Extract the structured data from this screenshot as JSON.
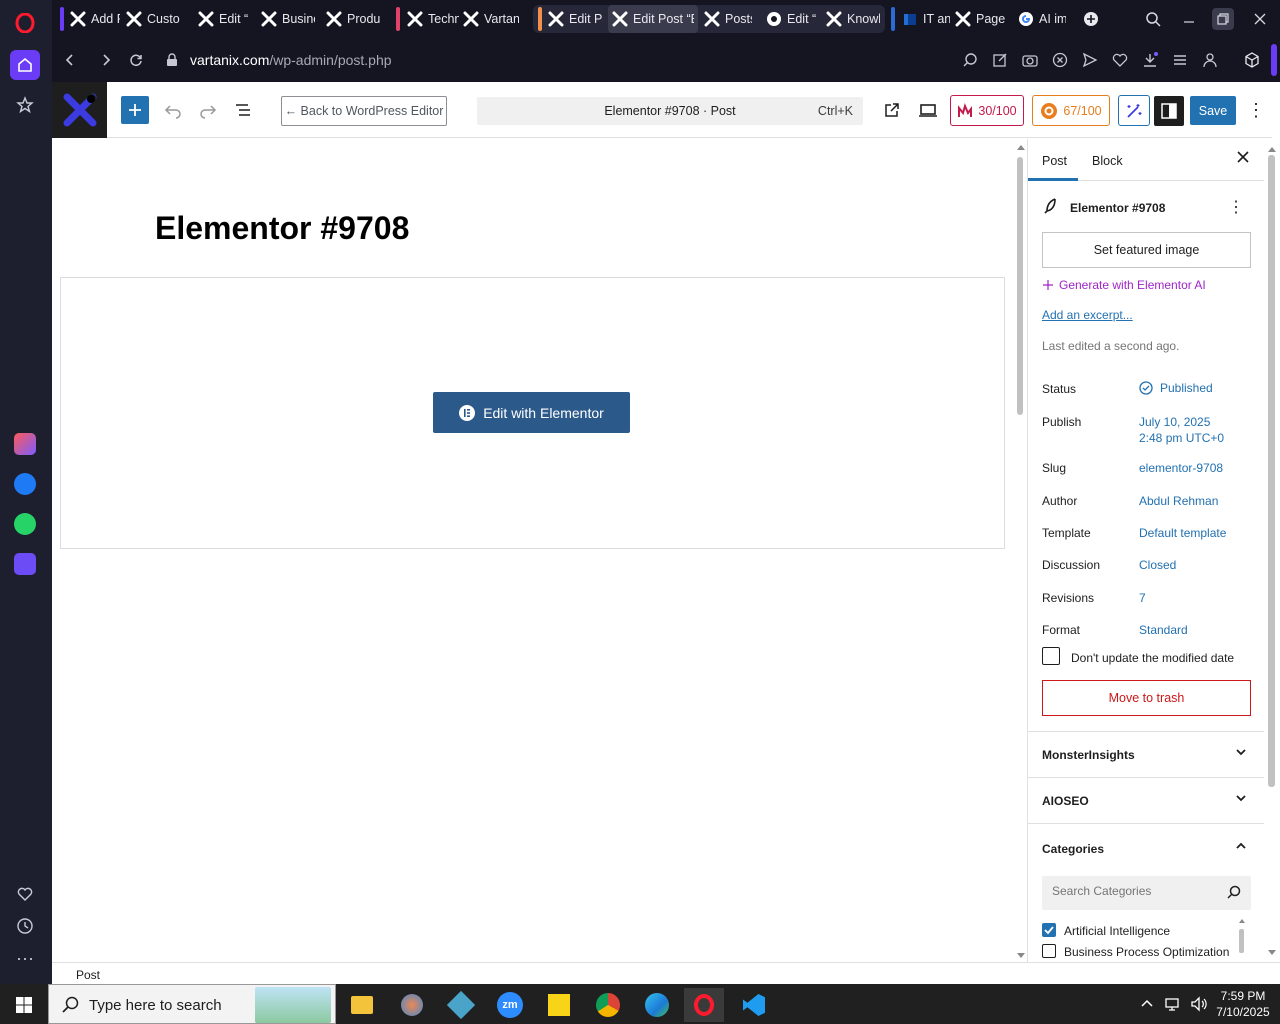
{
  "browser": {
    "tabs": [
      {
        "label": "Add P",
        "icon": "x-logo-icon"
      },
      {
        "label": "Custo",
        "icon": "x-logo-icon"
      },
      {
        "label": "Edit “A",
        "icon": "x-logo-icon"
      },
      {
        "label": "Busine",
        "icon": "x-logo-icon"
      },
      {
        "label": "Produ",
        "icon": "x-logo-icon"
      },
      {
        "label": "Techn",
        "icon": "x-logo-icon"
      },
      {
        "label": "Vartan",
        "icon": "x-logo-icon"
      },
      {
        "label": "Edit P",
        "icon": "x-logo-icon"
      },
      {
        "label": "Edit Post “E",
        "icon": "x-logo-icon"
      },
      {
        "label": "Posts",
        "icon": "x-logo-icon"
      },
      {
        "label": "Edit “I",
        "icon": "globe-icon"
      },
      {
        "label": "Knowl",
        "icon": "x-logo-icon"
      },
      {
        "label": "IT and",
        "icon": "calendar-icon"
      },
      {
        "label": "Pages",
        "icon": "x-logo-icon"
      },
      {
        "label": "AI ima",
        "icon": "google-icon"
      }
    ],
    "url_domain": "vartanix.com",
    "url_path": "/wp-admin/post.php"
  },
  "editor": {
    "back_label": "← Back to WordPress Editor",
    "command_title": "Elementor #9708 · Post",
    "command_shortcut": "Ctrl+K",
    "score1": "30/100",
    "score2": "67/100",
    "save_label": "Save",
    "post_title": "Elementor #9708",
    "edit_elementor_label": "Edit with Elementor",
    "status_footer": "Post"
  },
  "panel": {
    "tab_post": "Post",
    "tab_block": "Block",
    "post_name": "Elementor #9708",
    "featured_image": "Set featured image",
    "generate_ai": "Generate with Elementor AI",
    "add_excerpt": "Add an excerpt...",
    "last_edited": "Last edited a second ago.",
    "rows": [
      {
        "label": "Status",
        "value": "Published"
      },
      {
        "label": "Publish",
        "value": "July 10, 2025",
        "value2": "2:48 pm UTC+0"
      },
      {
        "label": "Slug",
        "value": "elementor-9708"
      },
      {
        "label": "Author",
        "value": "Abdul Rehman"
      },
      {
        "label": "Template",
        "value": "Default template"
      },
      {
        "label": "Discussion",
        "value": "Closed"
      },
      {
        "label": "Revisions",
        "value": "7"
      },
      {
        "label": "Format",
        "value": "Standard"
      }
    ],
    "dont_update": "Don't update the modified date",
    "move_trash": "Move to trash",
    "sections": [
      "MonsterInsights",
      "AIOSEO",
      "Categories"
    ],
    "search_categories_placeholder": "Search Categories",
    "categories": [
      {
        "label": "Artificial Intelligence",
        "checked": true
      },
      {
        "label": "Business Process Optimization",
        "checked": false
      }
    ]
  },
  "taskbar": {
    "search_placeholder": "Type here to search",
    "time": "7:59 PM",
    "date": "7/10/2025"
  },
  "colors": {
    "accent": "#2271b1",
    "save": "#2271b1",
    "elementor_btn": "#2b5a8a",
    "trash": "#cc1818",
    "score1": "#c31b4b",
    "score2": "#e87d1e"
  }
}
